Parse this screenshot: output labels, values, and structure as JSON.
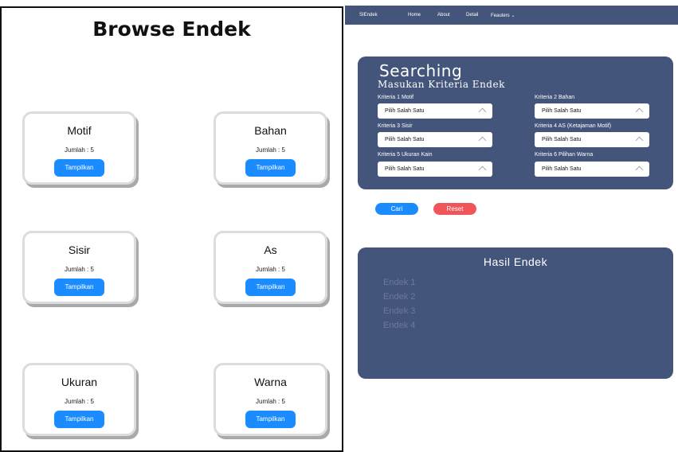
{
  "left": {
    "title": "Browse Endek",
    "cards": [
      {
        "title": "Motif",
        "count": "Jumlah : 5",
        "button": "Tampilkan"
      },
      {
        "title": "Bahan",
        "count": "Jumlah : 5",
        "button": "Tampilkan"
      },
      {
        "title": "Sisir",
        "count": "Jumlah : 5",
        "button": "Tampilkan"
      },
      {
        "title": "As",
        "count": "Jumlah : 5",
        "button": "Tampilkan"
      },
      {
        "title": "Ukuran",
        "count": "Jumlah : 5",
        "button": "Tampilkan"
      },
      {
        "title": "Warna",
        "count": "Jumlah : 5",
        "button": "Tampilkan"
      }
    ]
  },
  "nav": {
    "brand": "SIEndek",
    "items": [
      "Home",
      "About",
      "Detail",
      "Feauters ⌄"
    ]
  },
  "search": {
    "title": "Searching",
    "subtitle": "Masukan Kriteria Endek",
    "criteria": [
      {
        "label": "Kriteria 1 Motif",
        "value": "Pilih Salah Satu"
      },
      {
        "label": "Kriteria 2 Bahan",
        "value": "Pilih Salah Satu"
      },
      {
        "label": "Kriteria 3 Sisir",
        "value": "Pilih Salah Satu"
      },
      {
        "label": "Kriteria 4 AS (Ketajaman Motif)",
        "value": "Pilih Salah Satu"
      },
      {
        "label": "Kriteria 5 Ukuran Kain",
        "value": "Pilih Salah Satu"
      },
      {
        "label": "Kriteria 6 Pilihan Warna",
        "value": "Pilih Salah Satu"
      }
    ],
    "cari_label": "Cari",
    "reset_label": "Reset"
  },
  "results": {
    "title": "Hasil Endek",
    "items": [
      "Endek 1",
      "Endek 2",
      "Endek 3",
      "Endek 4"
    ]
  },
  "colors": {
    "panel": "#44557b",
    "primary_button": "#1a8cff",
    "reset_button": "#f0555a"
  }
}
